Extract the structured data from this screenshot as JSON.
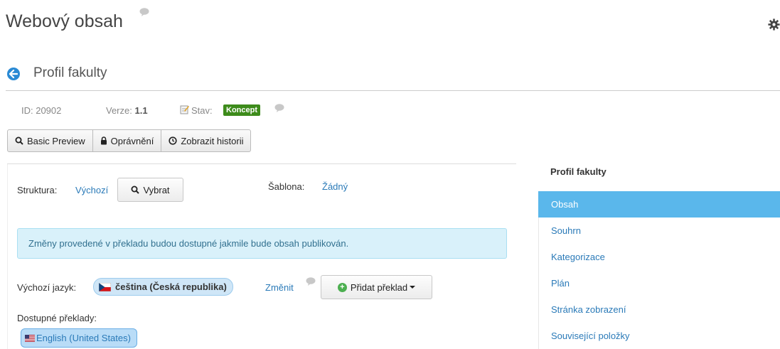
{
  "header": {
    "app_title": "Webový obsah"
  },
  "content": {
    "title": "Profil fakulty",
    "id_label": "ID: 20902",
    "version_prefix": "Verze:",
    "version_value": "1.1",
    "status_prefix": "Stav:",
    "status_badge": "Koncept"
  },
  "toolbar": {
    "preview_label": "Basic Preview",
    "permissions_label": "Oprávnění",
    "history_label": "Zobrazit historii"
  },
  "structure": {
    "label": "Struktura:",
    "value": "Výchozí",
    "select_label": "Vybrat",
    "template_label": "Šablona:",
    "template_value": "Žádný"
  },
  "info_message": "Změny provedené v překladu budou dostupné jakmile bude obsah publikován.",
  "language": {
    "default_label": "Výchozí jazyk:",
    "default_value": "čeština (Česká republika)",
    "change_label": "Změnit",
    "add_translation_label": "Přidat překlad",
    "available_label": "Dostupné překlady:",
    "translations": [
      "English (United States)"
    ]
  },
  "nav": {
    "title": "Profil fakulty",
    "items": [
      {
        "label": "Obsah",
        "active": true
      },
      {
        "label": "Souhrn"
      },
      {
        "label": "Kategorizace"
      },
      {
        "label": "Plán"
      },
      {
        "label": "Stránka zobrazení"
      },
      {
        "label": "Související položky"
      }
    ]
  },
  "colors": {
    "accent": "#5ab7eb",
    "link": "#2a7ab8",
    "status_badge": "#3d8b1b",
    "info_bg": "#d9f1fa"
  }
}
